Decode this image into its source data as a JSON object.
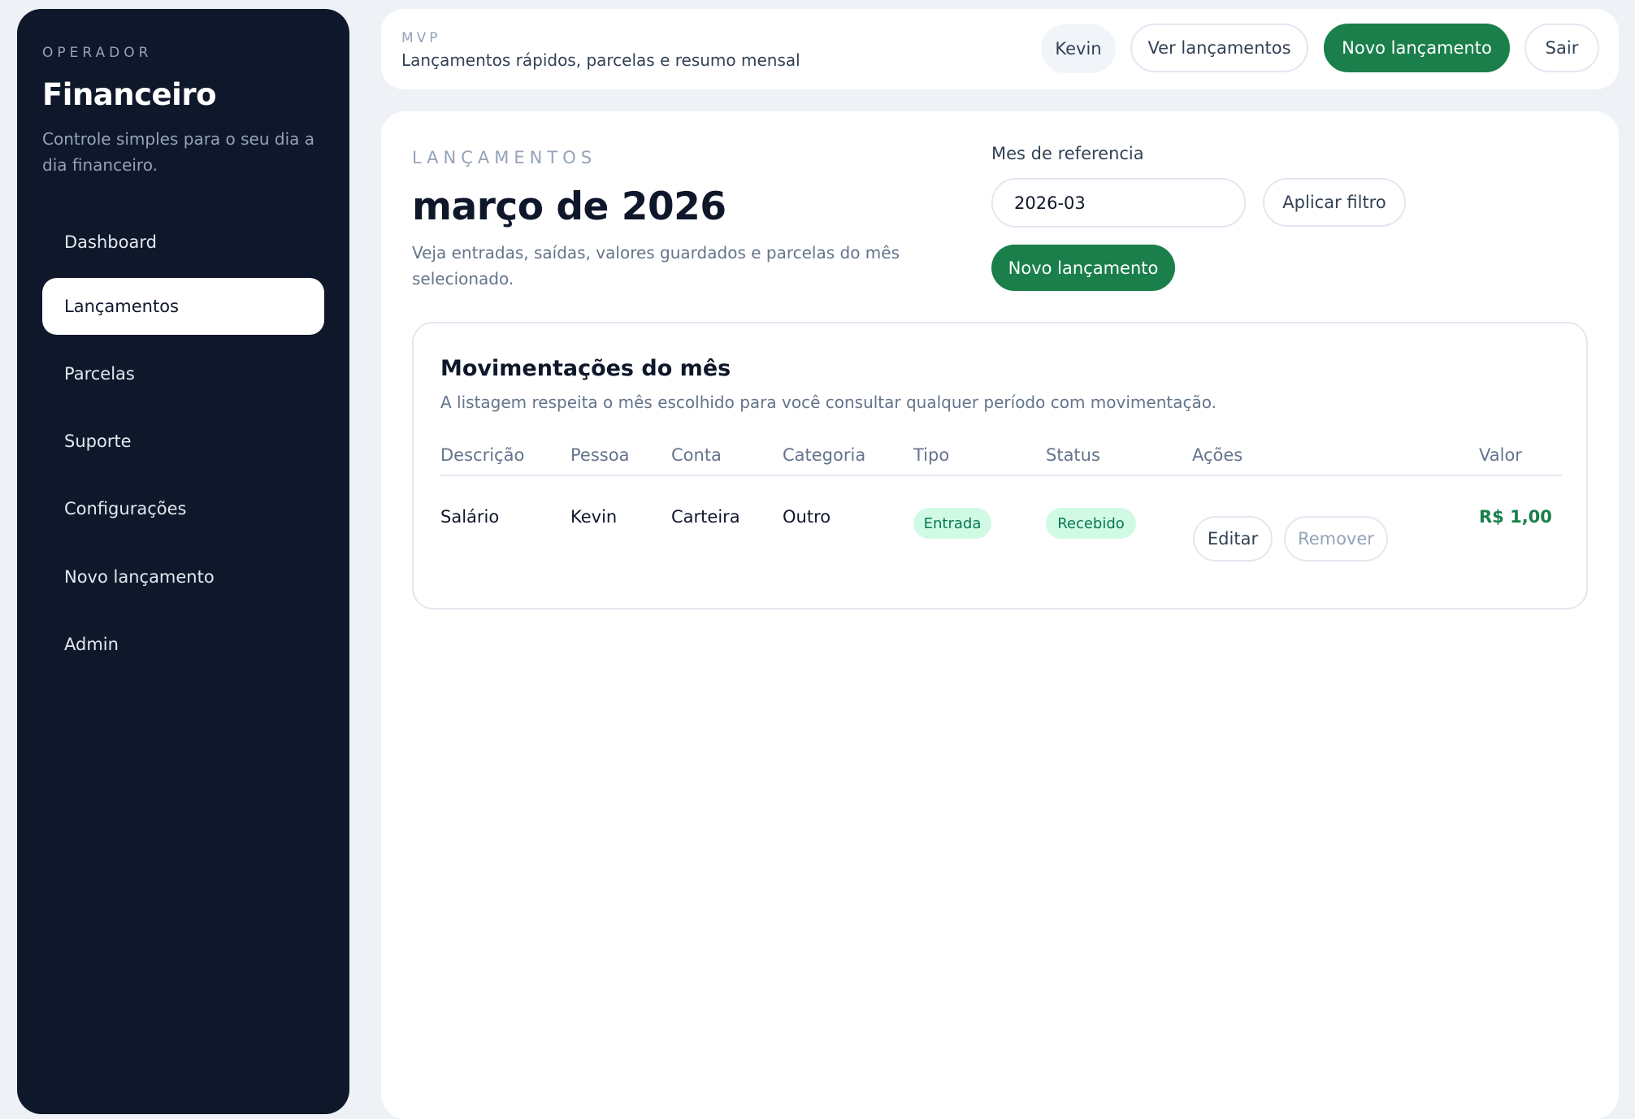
{
  "sidebar": {
    "kicker": "OPERADOR",
    "title": "Financeiro",
    "description": "Controle simples para o seu dia a dia financeiro.",
    "items": [
      {
        "label": "Dashboard"
      },
      {
        "label": "Lançamentos",
        "active": true
      },
      {
        "label": "Parcelas"
      },
      {
        "label": "Suporte"
      },
      {
        "label": "Configurações"
      },
      {
        "label": "Novo lançamento"
      },
      {
        "label": "Admin"
      }
    ]
  },
  "topbar": {
    "kicker": "MVP",
    "subtitle": "Lançamentos rápidos, parcelas e resumo mensal",
    "user": "Kevin",
    "view_entries_label": "Ver lançamentos",
    "new_entry_label": "Novo lançamento",
    "logout_label": "Sair"
  },
  "page": {
    "kicker": "LANÇAMENTOS",
    "title": "março de 2026",
    "description": "Veja entradas, saídas, valores guardados e parcelas do mês selecionado.",
    "filter": {
      "label": "Mes de referencia",
      "value": "2026-03",
      "apply_label": "Aplicar filtro"
    },
    "new_entry_label": "Novo lançamento"
  },
  "movements": {
    "title": "Movimentações do mês",
    "subtitle": "A listagem respeita o mês escolhido para você consultar qualquer período com movimentação.",
    "columns": [
      "Descrição",
      "Pessoa",
      "Conta",
      "Categoria",
      "Tipo",
      "Status",
      "Ações",
      "Valor"
    ],
    "rows": [
      {
        "description": "Salário",
        "person": "Kevin",
        "account": "Carteira",
        "category": "Outro",
        "type": "Entrada",
        "status": "Recebido",
        "edit_label": "Editar",
        "remove_label": "Remover",
        "value": "R$ 1,00"
      }
    ]
  },
  "colors": {
    "sidebar_bg": "#0f172a",
    "accent_green": "#1a7f4b",
    "badge_bg": "#d1fae5",
    "badge_text": "#047857",
    "page_bg": "#eef1f5"
  }
}
